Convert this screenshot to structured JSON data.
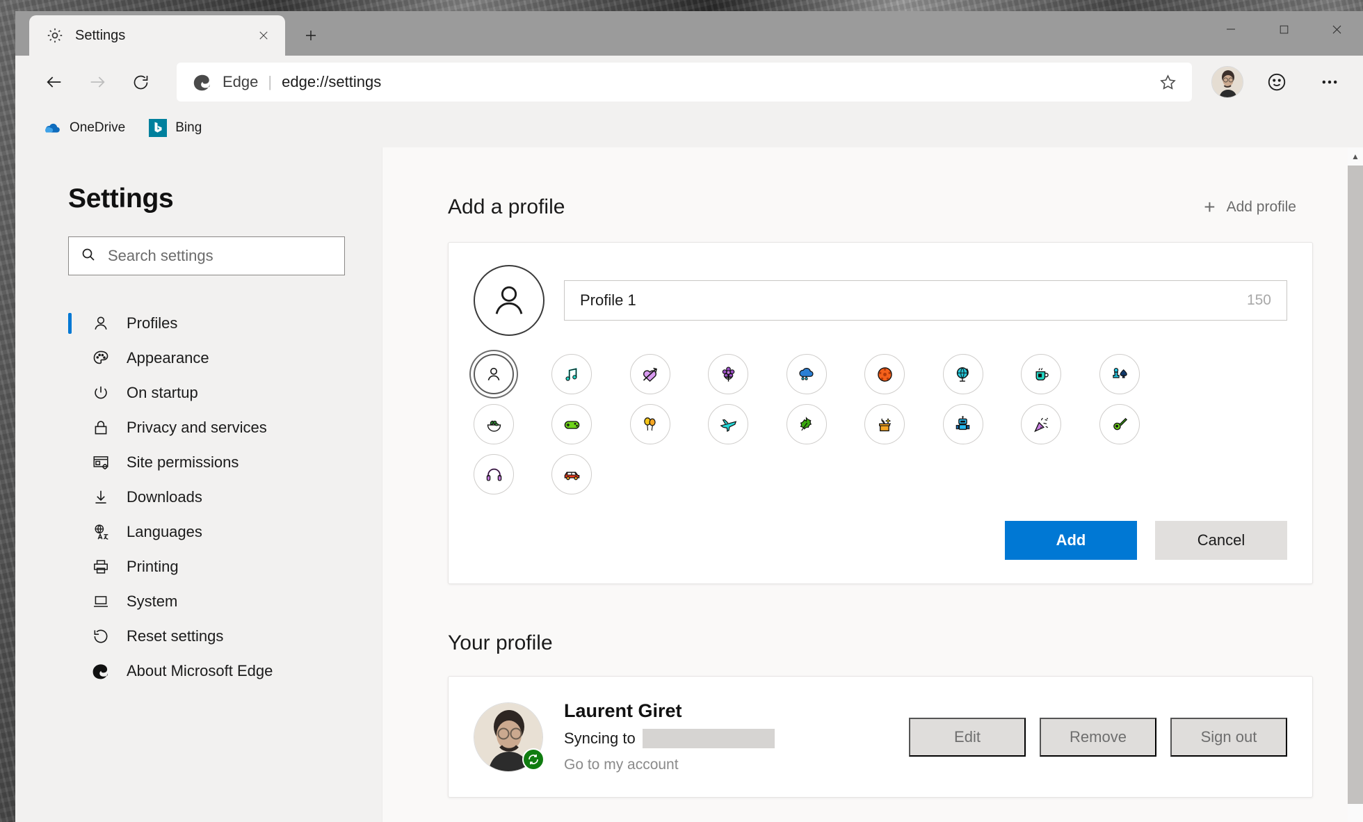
{
  "window": {
    "titlebar": {
      "tab": {
        "title": "Settings",
        "favicon_icon": "gear-icon",
        "close_icon": "close-icon"
      },
      "newtab_icon": "plus-icon",
      "controls": {
        "minimize": "minimize-icon",
        "maximize": "maximize-icon",
        "close": "close-icon"
      }
    },
    "toolbar": {
      "back_icon": "arrow-left-icon",
      "forward_icon": "arrow-right-icon",
      "refresh_icon": "refresh-icon",
      "omnibox": {
        "brand": "Edge",
        "separator": "|",
        "url": "edge://settings",
        "favorite_icon": "star-icon"
      },
      "profile_icon": "avatar-icon",
      "feedback_icon": "smiley-icon",
      "more_icon": "ellipsis-icon"
    },
    "bookmarks": [
      {
        "label": "OneDrive",
        "icon": "onedrive-cloud-icon"
      },
      {
        "label": "Bing",
        "icon": "bing-b-icon"
      }
    ]
  },
  "sidebar": {
    "title": "Settings",
    "search": {
      "placeholder": "Search settings",
      "value": "",
      "icon": "search-icon"
    },
    "items": [
      {
        "label": "Profiles",
        "icon": "person-icon",
        "active": true
      },
      {
        "label": "Appearance",
        "icon": "palette-icon",
        "active": false
      },
      {
        "label": "On startup",
        "icon": "power-icon",
        "active": false
      },
      {
        "label": "Privacy and services",
        "icon": "lock-icon",
        "active": false
      },
      {
        "label": "Site permissions",
        "icon": "site-permissions-icon",
        "active": false
      },
      {
        "label": "Downloads",
        "icon": "download-icon",
        "active": false
      },
      {
        "label": "Languages",
        "icon": "languages-icon",
        "active": false
      },
      {
        "label": "Printing",
        "icon": "printer-icon",
        "active": false
      },
      {
        "label": "System",
        "icon": "laptop-icon",
        "active": false
      },
      {
        "label": "Reset settings",
        "icon": "reset-icon",
        "active": false
      },
      {
        "label": "About Microsoft Edge",
        "icon": "edge-logo-icon",
        "active": false
      }
    ]
  },
  "main": {
    "add_profile": {
      "heading": "Add a profile",
      "add_button": {
        "label": "Add profile",
        "icon": "plus-icon"
      },
      "name_field": {
        "value": "Profile 1",
        "counter": "150"
      },
      "selected_avatar_index": 0,
      "avatars": [
        {
          "name": "person-avatar-icon",
          "color": "#1b1b1b"
        },
        {
          "name": "music-note-avatar-icon",
          "color": "#24d6c4"
        },
        {
          "name": "heart-arrow-avatar-icon",
          "color": "#d89af0"
        },
        {
          "name": "flower-avatar-icon",
          "color": "#9a4fc4"
        },
        {
          "name": "rain-cloud-avatar-icon",
          "color": "#2b7fd4"
        },
        {
          "name": "soccer-ball-avatar-icon",
          "color": "#f4601a"
        },
        {
          "name": "globe-avatar-icon",
          "color": "#24c4d6"
        },
        {
          "name": "tea-cup-avatar-icon",
          "color": "#24d6c4"
        },
        {
          "name": "game-pieces-avatar-icon",
          "color": "#24c4e0"
        },
        {
          "name": "salad-bowl-avatar-icon",
          "color": "#2e7d32"
        },
        {
          "name": "game-controller-avatar-icon",
          "color": "#6fd41a"
        },
        {
          "name": "balloons-avatar-icon",
          "color": "#f5c518"
        },
        {
          "name": "airplane-avatar-icon",
          "color": "#24d6d6"
        },
        {
          "name": "leaf-avatar-icon",
          "color": "#3aa80f"
        },
        {
          "name": "gift-box-avatar-icon",
          "color": "#f5a623"
        },
        {
          "name": "robot-avatar-icon",
          "color": "#24b8f0"
        },
        {
          "name": "party-popper-avatar-icon",
          "color": "#c77ce0"
        },
        {
          "name": "guitar-avatar-icon",
          "color": "#6fd41a"
        },
        {
          "name": "headphones-avatar-icon",
          "color": "#c77ce0"
        },
        {
          "name": "car-avatar-icon",
          "color": "#f03a1a"
        }
      ],
      "actions": {
        "add": "Add",
        "cancel": "Cancel"
      }
    },
    "your_profile": {
      "heading": "Your profile",
      "name": "Laurent Giret",
      "sync_label": "Syncing to",
      "sync_value_redacted": true,
      "account_link": "Go to my account",
      "sync_badge_icon": "sync-icon",
      "buttons": [
        {
          "label": "Edit"
        },
        {
          "label": "Remove"
        },
        {
          "label": "Sign out"
        }
      ]
    }
  },
  "colors": {
    "accent": "#0078d4",
    "sync_green": "#107c10",
    "sidebar_bg": "#f2f1f0",
    "content_bg": "#faf9f8"
  }
}
